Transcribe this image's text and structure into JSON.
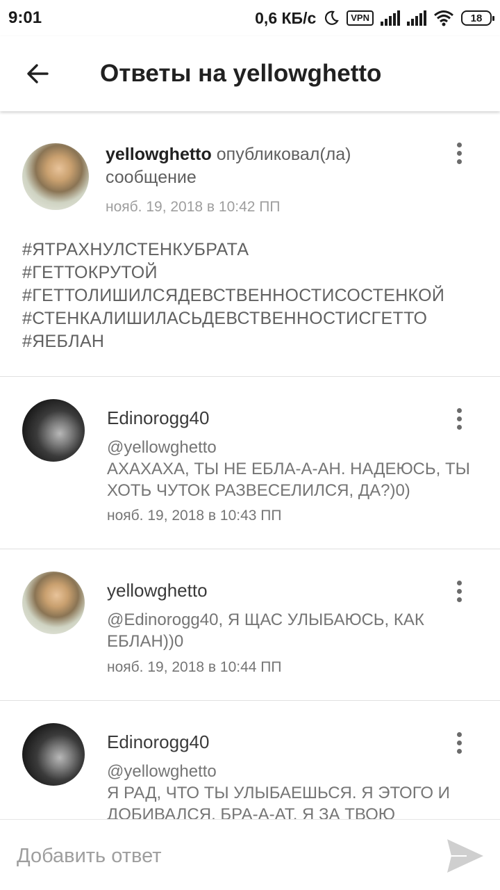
{
  "status_bar": {
    "time": "9:01",
    "speed": "0,6 КБ/с",
    "vpn": "VPN",
    "battery": "18"
  },
  "app_bar": {
    "title": "Ответы на yellowghetto"
  },
  "post": {
    "author": "yellowghetto",
    "action": "опубликовал(ла) сообщение",
    "time": "нояб. 19, 2018 в 10:42 ПП",
    "lines": [
      "#ЯТРАХНУЛСТЕНКУБРАТА",
      "#ГЕТТОКРУТОЙ",
      "#ГЕТТОЛИШИЛСЯДЕВСТВЕННОСТИСОСТЕНКОЙ",
      "#СТЕНКАЛИШИЛАСЬДЕВСТВЕННОСТИСГЕТТО",
      "#ЯЕБЛАН"
    ]
  },
  "comments": [
    {
      "author": "Edinorogg40",
      "text": "@yellowghetto\nАХАХАХА, ТЫ НЕ ЕБЛА-А-АН. НАДЕЮСЬ, ТЫ ХОТЬ ЧУТОК РАЗВЕСЕЛИЛСЯ, ДА?)0)",
      "time": "нояб. 19, 2018 в 10:43 ПП"
    },
    {
      "author": "yellowghetto",
      "text": "@Edinorogg40, Я ЩАС УЛЫБАЮСЬ, КАК ЕБЛАН))0",
      "time": "нояб. 19, 2018 в 10:44 ПП"
    },
    {
      "author": "Edinorogg40",
      "text": "@yellowghetto\nЯ РАД, ЧТО ТЫ УЛЫБАЕШЬСЯ. Я ЭТОГО И ДОБИВАЛСЯ. БРА-А-АТ. Я ЗА ТВОЮ",
      "time": ""
    }
  ],
  "reply": {
    "placeholder": "Добавить ответ"
  },
  "colors": {
    "text_primary": "#212121",
    "text_secondary": "#757575",
    "divider": "#e0e0e0",
    "send_icon": "#cfcfcf"
  },
  "icons": {
    "back": "arrow-left",
    "more": "more-vertical",
    "send": "send",
    "status": [
      "moon",
      "signal",
      "wifi",
      "battery"
    ]
  }
}
